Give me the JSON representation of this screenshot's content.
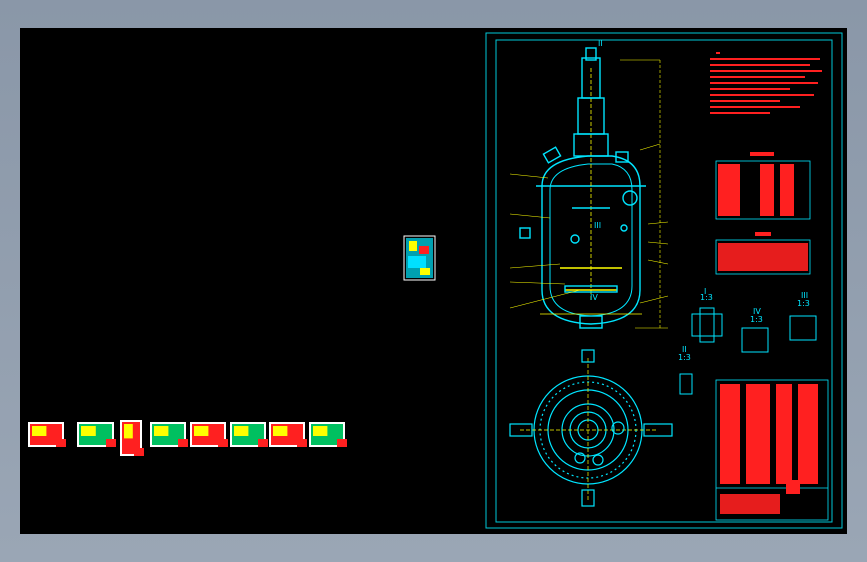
{
  "viewer": {
    "background": "#000000",
    "frame_color": "#00c8d8",
    "line_color": "#00e5ff",
    "text_color": "#ff2020",
    "note_color": "#ffff00"
  },
  "main_sheet": {
    "section_labels": [
      {
        "roman": "I",
        "scale": "1:3"
      },
      {
        "roman": "II",
        "scale": "1:3"
      },
      {
        "roman": "III",
        "scale": "1:3"
      },
      {
        "roman": "IV",
        "scale": "1:3"
      }
    ],
    "callouts": [
      "II",
      "III",
      "IV"
    ]
  },
  "thumbnails": [
    {
      "id": "sheet-1"
    },
    {
      "id": "sheet-2"
    },
    {
      "id": "sheet-3"
    },
    {
      "id": "sheet-4"
    },
    {
      "id": "sheet-5"
    },
    {
      "id": "sheet-6"
    },
    {
      "id": "sheet-7"
    },
    {
      "id": "sheet-8"
    }
  ],
  "mini_sheet": {
    "id": "sheet-mini"
  }
}
